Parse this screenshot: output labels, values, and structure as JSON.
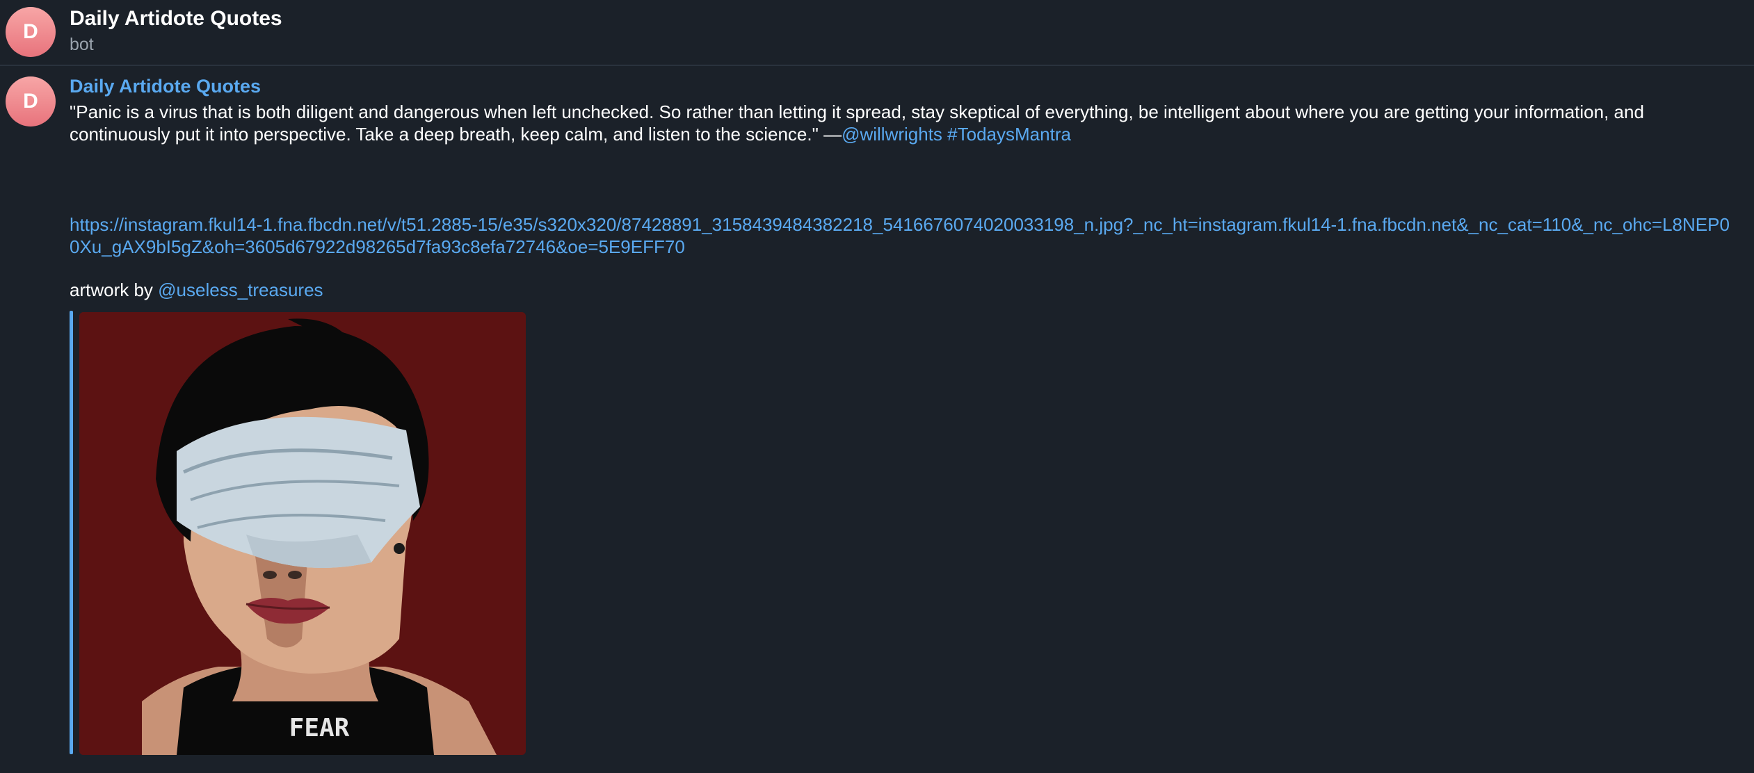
{
  "header": {
    "avatar_letter": "D",
    "title": "Daily Artidote Quotes",
    "subtitle": "bot"
  },
  "message": {
    "avatar_letter": "D",
    "sender": "Daily Artidote Quotes",
    "quote": "\"Panic is a virus that is both diligent and dangerous when left unchecked. So rather than letting it spread, stay skeptical of everything, be intelligent about where you are getting your information, and continuously put it into perspective. Take a deep breath, keep calm, and listen to the science.\" —",
    "mention": "@willwrights",
    "hashtag": "#TodaysMantra",
    "url": "https://instagram.fkul14-1.fna.fbcdn.net/v/t51.2885-15/e35/s320x320/87428891_3158439484382218_5416676074020033198_n.jpg?_nc_ht=instagram.fkul14-1.fna.fbcdn.net&_nc_cat=110&_nc_ohc=L8NEP00Xu_gAX9bI5gZ&oh=3605d67922d98265d7fa93c8efa72746&oe=5E9EFF70",
    "artwork_prefix": "artwork by ",
    "artwork_mention": "@useless_treasures",
    "image_shirt_text": "FEAR"
  },
  "colors": {
    "background": "#1b2129",
    "accent": "#5aa9f0",
    "avatar_gradient_top": "#f7a6a6",
    "avatar_gradient_bottom": "#e8737c"
  }
}
